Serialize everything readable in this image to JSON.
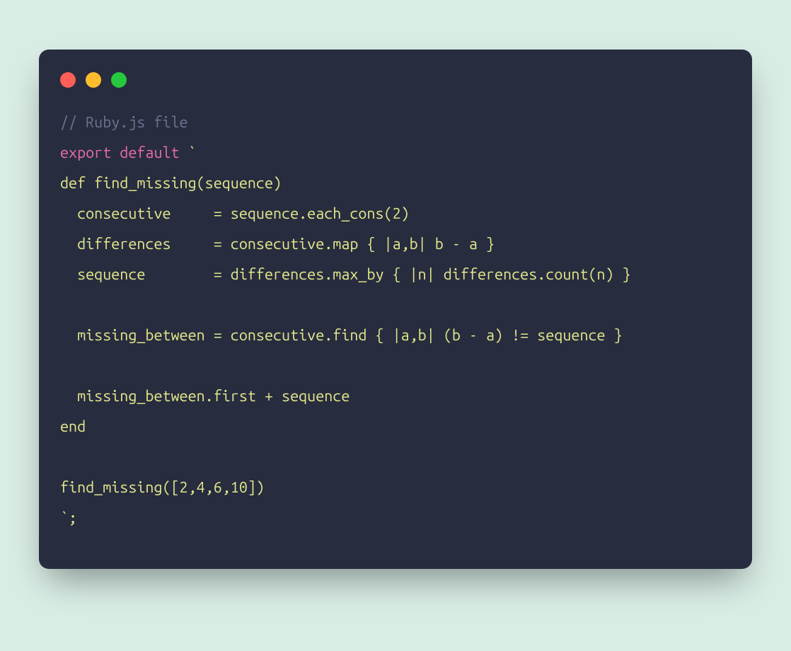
{
  "window": {
    "controls": {
      "red_label": "close-button",
      "yellow_label": "minimize-button",
      "green_label": "maximize-button"
    }
  },
  "code": {
    "line1_comment": "// Ruby.js file",
    "line2_export": "export",
    "line2_default": " default ",
    "line2_backtick": "`",
    "line3": "def find_missing(sequence)",
    "line4": "  consecutive     = sequence.each_cons(2)",
    "line5": "  differences     = consecutive.map { |a,b| b - a }",
    "line6": "  sequence        = differences.max_by { |n| differences.count(n) }",
    "line7": "",
    "line8": "  missing_between = consecutive.find { |a,b| (b - a) != sequence }",
    "line9": "",
    "line10": "  missing_between.first + sequence",
    "line11": "end",
    "line12": "",
    "line13": "find_missing([2,4,6,10])",
    "line14_backtick": "`",
    "line14_semi": ";"
  }
}
